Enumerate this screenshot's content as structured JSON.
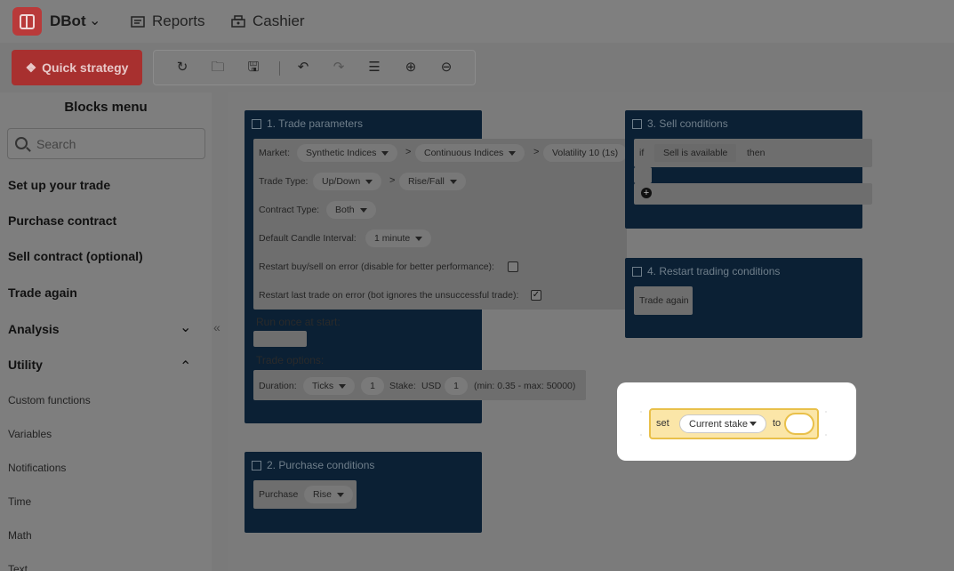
{
  "header": {
    "app_name": "DBot",
    "nav": [
      {
        "label": "Reports",
        "icon": "reports-icon"
      },
      {
        "label": "Cashier",
        "icon": "cashier-icon"
      }
    ]
  },
  "toolbar": {
    "quick_strategy": "Quick strategy",
    "icons": [
      "reset-icon",
      "open-icon",
      "save-icon",
      "undo-icon",
      "redo-icon",
      "sort-icon",
      "zoom-in-icon",
      "zoom-out-icon"
    ]
  },
  "sidebar": {
    "title": "Blocks menu",
    "search_placeholder": "Search",
    "categories": [
      {
        "label": "Set up your trade"
      },
      {
        "label": "Purchase contract"
      },
      {
        "label": "Sell contract (optional)"
      },
      {
        "label": "Trade again"
      },
      {
        "label": "Analysis",
        "chevron": "chevron-down-icon"
      },
      {
        "label": "Utility",
        "chevron": "chevron-up-icon"
      }
    ],
    "utility_items": [
      "Custom functions",
      "Variables",
      "Notifications",
      "Time",
      "Math",
      "Text"
    ]
  },
  "trade_params": {
    "title": "1. Trade parameters",
    "market_label": "Market:",
    "market": [
      "Synthetic Indices",
      "Continuous Indices",
      "Volatility 10 (1s)"
    ],
    "trade_type_label": "Trade Type:",
    "trade_type": [
      "Up/Down",
      "Rise/Fall"
    ],
    "contract_type_label": "Contract Type:",
    "contract_type": "Both",
    "candle_label": "Default Candle Interval:",
    "candle": "1 minute",
    "restart_buy_sell": "Restart buy/sell on error (disable for better performance):",
    "restart_last_trade": "Restart last trade on error (bot ignores the unsuccessful trade):",
    "run_once": "Run once at start:",
    "trade_options": "Trade options:",
    "duration_label": "Duration:",
    "duration_unit": "Ticks",
    "duration_value": "1",
    "stake_label": "Stake:",
    "currency": "USD",
    "stake_value": "1",
    "limits": "(min: 0.35 - max: 50000)"
  },
  "purchase": {
    "title": "2. Purchase conditions",
    "label": "Purchase",
    "value": "Rise"
  },
  "sell": {
    "title": "3. Sell conditions",
    "if": "if",
    "condition": "Sell is available",
    "then": "then"
  },
  "restart": {
    "title": "4. Restart trading conditions",
    "trade_again": "Trade again"
  },
  "highlight_block": {
    "set": "set",
    "variable": "Current stake",
    "to": "to"
  }
}
